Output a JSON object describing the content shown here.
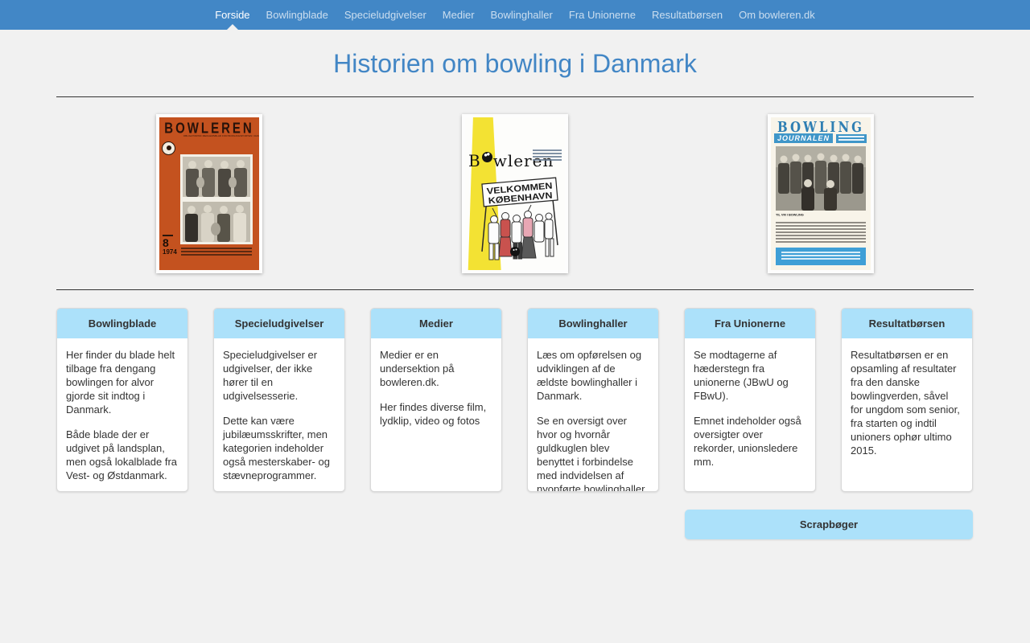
{
  "nav": {
    "items": [
      {
        "label": "Forside",
        "active": true
      },
      {
        "label": "Bowlingblade",
        "active": false
      },
      {
        "label": "Specieludgivelser",
        "active": false
      },
      {
        "label": "Medier",
        "active": false
      },
      {
        "label": "Bowlinghaller",
        "active": false
      },
      {
        "label": "Fra Unionerne",
        "active": false
      },
      {
        "label": "Resultatbørsen",
        "active": false
      },
      {
        "label": "Om bowleren.dk",
        "active": false
      }
    ]
  },
  "page": {
    "title": "Historien om bowling i Danmark"
  },
  "covers": {
    "bowleren1974": {
      "title": "BOWLEREN",
      "subtitle": "OBLIGATORISK MEDLEMSBLAD FOR BOWLINGSPORTEN I DANMARK",
      "issue_number": "8",
      "issue_year": "1974"
    },
    "bowlerenVelkommen": {
      "title_prefix": "B",
      "title_suffix": "wleren",
      "banner_line1": "VELKOMMEN",
      "banner_line2": "KØBENHAVN"
    },
    "bowlingJournalen": {
      "title_line1": "BOWLING",
      "title_line2": "JOURNALEN",
      "photo_heading": "TIL VM I BOWLING"
    }
  },
  "cards": [
    {
      "title": "Bowlingblade",
      "paragraphs": [
        "Her finder du blade helt tilbage fra dengang bowlingen for alvor gjorde sit indtog i Danmark.",
        "Både blade der er udgivet på landsplan, men også lokalblade fra Vest- og Østdanmark."
      ]
    },
    {
      "title": "Specieludgivelser",
      "paragraphs": [
        "Specieludgivelser er udgivelser, der ikke hører til en udgivelsesserie.",
        "Dette kan være jubilæumsskrifter, men kategorien indeholder også mesterskaber- og stævneprogrammer."
      ]
    },
    {
      "title": "Medier",
      "paragraphs": [
        "Medier er en undersektion på bowleren.dk.",
        "Her findes diverse film, lydklip, video og fotos"
      ]
    },
    {
      "title": "Bowlinghaller",
      "paragraphs": [
        "Læs om opførelsen og udviklingen af de ældste bowlinghaller i Danmark.",
        "Se en oversigt over hvor og hvornår guldkuglen blev benyttet i forbindelse med indvidelsen af nyopførte bowlinghaller."
      ]
    },
    {
      "title": "Fra Unionerne",
      "paragraphs": [
        "Se modtagerne af hæderstegn fra unionerne (JBwU og FBwU).",
        "Emnet indeholder også oversigter over rekorder, unionsledere mm."
      ]
    },
    {
      "title": "Resultatbørsen",
      "paragraphs": [
        "Resultatbørsen er en opsamling af resultater fra den danske bowlingverden, såvel for ungdom som senior, fra starten og indtil unioners ophør ultimo 2015."
      ]
    }
  ],
  "scrapbooks": {
    "label": "Scrapbøger"
  },
  "colors": {
    "navbar": "#4287c6",
    "title": "#4286c5",
    "card_header": "#ace1fa",
    "cover1_orange": "#c4521f",
    "cover2_yellow": "#f3e233",
    "cover3_blue": "#3f96c8"
  }
}
